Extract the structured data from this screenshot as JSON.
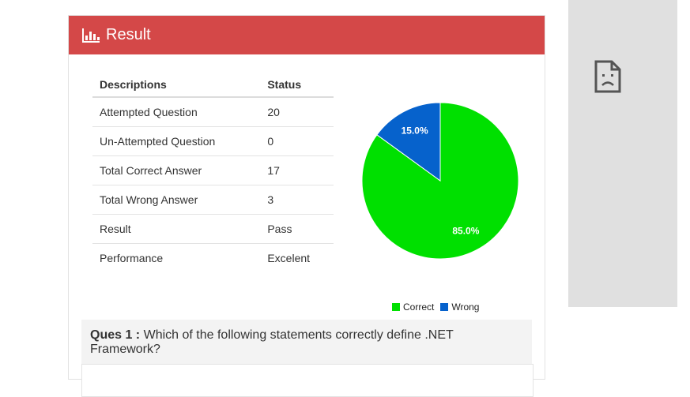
{
  "panel": {
    "title": "Result"
  },
  "table": {
    "headers": [
      "Descriptions",
      "Status"
    ],
    "rows": [
      [
        "Attempted Question",
        "20"
      ],
      [
        "Un-Attempted Question",
        "0"
      ],
      [
        "Total Correct Answer",
        "17"
      ],
      [
        "Total Wrong Answer",
        "3"
      ],
      [
        "Result",
        "Pass"
      ],
      [
        "Performance",
        "Excelent"
      ]
    ]
  },
  "chart_data": {
    "type": "pie",
    "categories": [
      "Correct",
      "Wrong"
    ],
    "values": [
      85.0,
      15.0
    ],
    "labels": [
      "85.0%",
      "15.0%"
    ],
    "colors": [
      "#00e000",
      "#0662cc"
    ],
    "legend_position": "bottom"
  },
  "question": {
    "prefix": "Ques 1 :",
    "text": "Which of the following statements correctly define .NET Framework?"
  },
  "icons": {
    "header": "bar-chart-icon",
    "ad": "broken-document-icon"
  }
}
